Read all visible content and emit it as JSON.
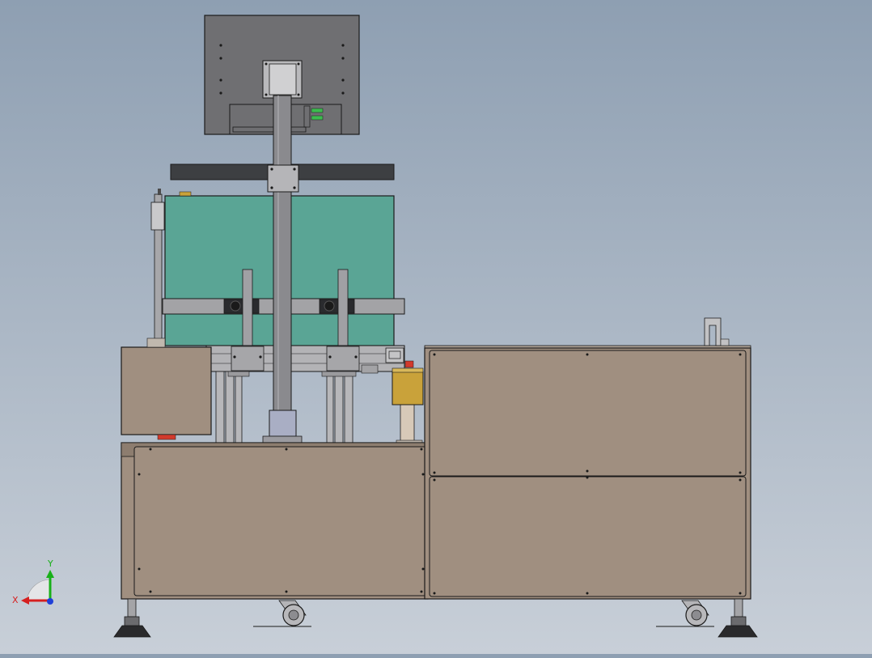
{
  "viewport": {
    "background_top": "#8e9fb2",
    "background_bottom": "#c8cfd8",
    "line_color": "#1a1a1a"
  },
  "model": {
    "colors": {
      "cabinet": "#a08f80",
      "cabinet_dark": "#8d7d6f",
      "enclosure": "#5aa595",
      "monitor": "#6f6f72",
      "pole": "#8a8a8e",
      "rail": "#9b9b9f",
      "dark_bar": "#3d3f42",
      "gold": "#c9a23a",
      "green_connector": "#3dbb4f",
      "red_part": "#d23a2c"
    }
  },
  "triad": {
    "x_label": "X",
    "y_label": "Y",
    "x_color": "#d62020",
    "y_color": "#18b018",
    "z_color": "#2040d8"
  }
}
